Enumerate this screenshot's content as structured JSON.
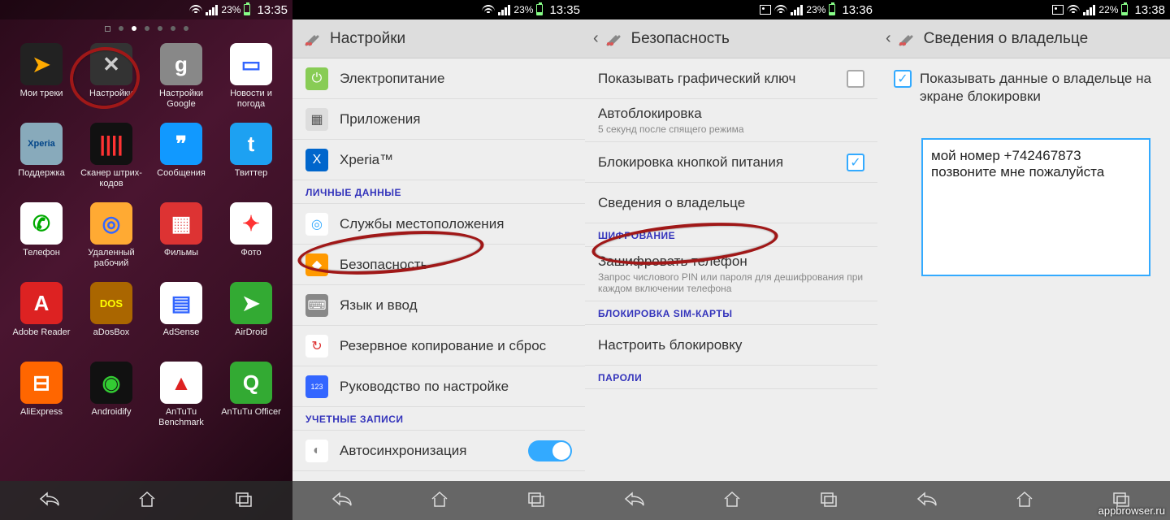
{
  "watermark": "appbrowser.ru",
  "status": [
    {
      "pct": "23%",
      "time": "13:35",
      "picture": false
    },
    {
      "pct": "23%",
      "time": "13:35",
      "picture": false
    },
    {
      "pct": "23%",
      "time": "13:36",
      "picture": true
    },
    {
      "pct": "22%",
      "time": "13:38",
      "picture": true
    }
  ],
  "home": {
    "apps": [
      {
        "label": "Мои треки",
        "bg": "#222",
        "glyph": "➤",
        "fg": "#fa0"
      },
      {
        "label": "Настройки",
        "bg": "#333",
        "glyph": "✕",
        "fg": "#ccc"
      },
      {
        "label": "Настройки Google",
        "bg": "#888",
        "glyph": "g",
        "fg": "#fff"
      },
      {
        "label": "Новости и погода",
        "bg": "#fff",
        "glyph": "▭",
        "fg": "#36f"
      },
      {
        "label": "Поддержка",
        "bg": "#8ab",
        "glyph": "Xperia",
        "fg": "#048",
        "fs": "11"
      },
      {
        "label": "Сканер штрих-кодов",
        "bg": "#111",
        "glyph": "||||",
        "fg": "#f33"
      },
      {
        "label": "Сообщения",
        "bg": "#19f",
        "glyph": "❞",
        "fg": "#fff"
      },
      {
        "label": "Твиттер",
        "bg": "#1da1f2",
        "glyph": "t",
        "fg": "#fff"
      },
      {
        "label": "Телефон",
        "bg": "#fff",
        "glyph": "✆",
        "fg": "#0a0"
      },
      {
        "label": "Удаленный рабочий",
        "bg": "#fa3",
        "glyph": "◎",
        "fg": "#36f"
      },
      {
        "label": "Фильмы",
        "bg": "#d33",
        "glyph": "▦",
        "fg": "#fff"
      },
      {
        "label": "Фото",
        "bg": "#fff",
        "glyph": "✦",
        "fg": "#f33"
      },
      {
        "label": "Adobe Reader",
        "bg": "#d22",
        "glyph": "A",
        "fg": "#fff"
      },
      {
        "label": "aDosBox",
        "bg": "#a60",
        "glyph": "DOS",
        "fg": "#ff0",
        "fs": "13"
      },
      {
        "label": "AdSense",
        "bg": "#fff",
        "glyph": "▤",
        "fg": "#36f"
      },
      {
        "label": "AirDroid",
        "bg": "#3a3",
        "glyph": "➤",
        "fg": "#fff"
      },
      {
        "label": "AliExpress",
        "bg": "#f60",
        "glyph": "⊟",
        "fg": "#fff"
      },
      {
        "label": "Androidify",
        "bg": "#111",
        "glyph": "◉",
        "fg": "#3c3"
      },
      {
        "label": "AnTuTu Benchmark",
        "bg": "#fff",
        "glyph": "▲",
        "fg": "#d22"
      },
      {
        "label": "AnTuTu Officer",
        "bg": "#3a3",
        "glyph": "Q",
        "fg": "#fff"
      }
    ]
  },
  "settings": {
    "title": "Настройки",
    "rows": [
      {
        "icon_bg": "#8c5",
        "icon_fg": "#fff",
        "glyph": "⏻",
        "label": "Электропитание"
      },
      {
        "icon_bg": "#ddd",
        "icon_fg": "#555",
        "glyph": "▦",
        "label": "Приложения"
      },
      {
        "icon_bg": "#06c",
        "icon_fg": "#fff",
        "glyph": "X",
        "label": "Xperia™"
      }
    ],
    "section1": "ЛИЧНЫЕ ДАННЫЕ",
    "rows2": [
      {
        "icon_bg": "#fff",
        "icon_fg": "#3af",
        "glyph": "◎",
        "label": "Службы местоположения"
      },
      {
        "icon_bg": "#f90",
        "icon_fg": "#fff",
        "glyph": "◆",
        "label": "Безопасность",
        "circled": true
      },
      {
        "icon_bg": "#888",
        "icon_fg": "#fff",
        "glyph": "⌨",
        "label": "Язык и ввод"
      },
      {
        "icon_bg": "#fff",
        "icon_fg": "#d33",
        "glyph": "↻",
        "label": "Резервное копирование и сброс"
      },
      {
        "icon_bg": "#36f",
        "icon_fg": "#fff",
        "glyph": "123",
        "label": "Руководство по настройке",
        "fs": "9"
      }
    ],
    "section2": "УЧЕТНЫЕ ЗАПИСИ",
    "rows3": [
      {
        "icon_bg": "#fff",
        "icon_fg": "#888",
        "glyph": "◐",
        "label": "Автосинхронизация",
        "toggle": true
      }
    ]
  },
  "security": {
    "title": "Безопасность",
    "rows": [
      {
        "label": "Показывать графический ключ",
        "check": "off"
      },
      {
        "label": "Автоблокировка",
        "sub": "5 секунд после спящего режима"
      },
      {
        "label": "Блокировка кнопкой питания",
        "check": "on"
      },
      {
        "label": "Сведения о владельце",
        "circled": true
      }
    ],
    "section1": "ШИФРОВАНИЕ",
    "rows2": [
      {
        "label": "Зашифровать телефон",
        "sub": "Запрос числового PIN или пароля для дешифрования при каждом включении телефона"
      }
    ],
    "section2": "БЛОКИРОВКА SIM-КАРТЫ",
    "rows3": [
      {
        "label": "Настроить блокировку"
      }
    ],
    "section3": "ПАРОЛИ"
  },
  "owner": {
    "title": "Сведения о владельце",
    "check_label": "Показывать данные о владельце на экране блокировки",
    "text": "мой номер +742467873 позвоните мне пожалуйста"
  }
}
